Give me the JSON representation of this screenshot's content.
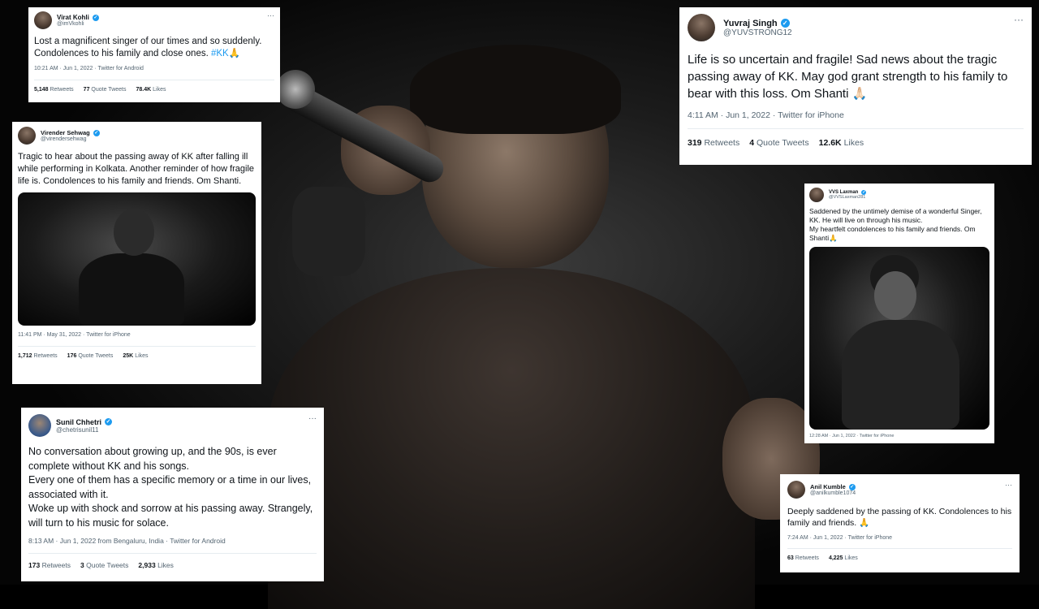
{
  "tweets": {
    "kohli": {
      "name": "Virat Kohli",
      "handle": "@imVkohli",
      "text": "Lost a magnificent singer of our times and so suddenly.\nCondolences to his family and close ones. ",
      "hashtag": "#KK🙏",
      "meta": "10:21 AM · Jun 1, 2022 · Twitter for Android",
      "retweets_num": "5,148",
      "retweets_label": "Retweets",
      "quotes_num": "77",
      "quotes_label": "Quote Tweets",
      "likes_num": "78.4K",
      "likes_label": "Likes"
    },
    "sehwag": {
      "name": "Virender Sehwag",
      "handle": "@virendersehwag",
      "text": "Tragic to hear about the passing away of KK after falling ill while performing in Kolkata. Another reminder of how fragile life is. Condolences to his family and friends. Om Shanti.",
      "meta": "11:41 PM · May 31, 2022 · Twitter for iPhone",
      "retweets_num": "1,712",
      "retweets_label": "Retweets",
      "quotes_num": "176",
      "quotes_label": "Quote Tweets",
      "likes_num": "25K",
      "likes_label": "Likes"
    },
    "chhetri": {
      "name": "Sunil Chhetri",
      "handle": "@chetrisunil11",
      "text": "No conversation about growing up, and the 90s, is ever complete without KK and his songs.\nEvery one of them has a specific memory or a time in our lives, associated with it.\nWoke up with shock and sorrow at his passing away. Strangely, will turn to his music for solace.",
      "meta": "8:13 AM · Jun 1, 2022 from Bengaluru, India · Twitter for Android",
      "retweets_num": "173",
      "retweets_label": "Retweets",
      "quotes_num": "3",
      "quotes_label": "Quote Tweets",
      "likes_num": "2,933",
      "likes_label": "Likes"
    },
    "yuvraj": {
      "name": "Yuvraj Singh",
      "handle": "@YUVSTRONG12",
      "text": "Life is so uncertain and fragile! Sad news about the tragic passing away of KK. May god grant strength to his family to bear with this loss. Om Shanti 🙏🏻",
      "meta": "4:11 AM · Jun 1, 2022 · Twitter for iPhone",
      "retweets_num": "319",
      "retweets_label": "Retweets",
      "quotes_num": "4",
      "quotes_label": "Quote Tweets",
      "likes_num": "12.6K",
      "likes_label": "Likes"
    },
    "laxman": {
      "name": "VVS Laxman",
      "handle": "@VVSLaxman281",
      "text": "Saddened by the untimely demise of a wonderful Singer, KK. He will live on through his music.\nMy heartfelt condolences to his family and friends. Om Shanti🙏",
      "meta": "12:28 AM · Jun 1, 2022 · Twitter for iPhone"
    },
    "kumble": {
      "name": "Anil Kumble",
      "handle": "@anilkumble1074",
      "text": "Deeply saddened by the passing of KK. Condolences to his family and friends. 🙏",
      "meta": "7:24 AM · Jun 1, 2022 · Twitter for iPhone",
      "retweets_num": "63",
      "retweets_label": "Retweets",
      "likes_num": "4,225",
      "likes_label": "Likes"
    }
  },
  "icons": {
    "verified": "✓",
    "more": "···"
  },
  "colors": {
    "link": "#1d9bf0",
    "verified": "#1d9bf0",
    "background": "#000000"
  }
}
